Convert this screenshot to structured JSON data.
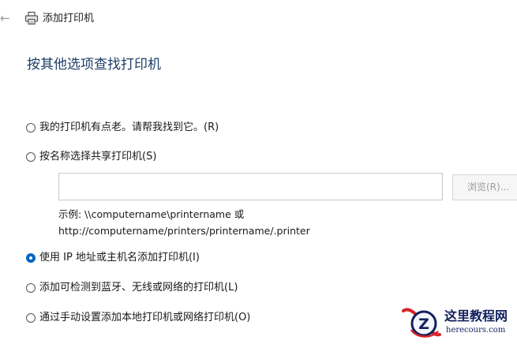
{
  "header": {
    "back_icon": "arrow-left-icon",
    "printer_icon": "printer-icon",
    "title": "添加打印机"
  },
  "page": {
    "heading": "按其他选项查找打印机"
  },
  "options": [
    {
      "label": "我的打印机有点老。请帮我找到它。(R)",
      "selected": false
    },
    {
      "label": "按名称选择共享打印机(S)",
      "selected": false
    },
    {
      "label": "使用 IP 地址或主机名添加打印机(I)",
      "selected": true
    },
    {
      "label": "添加可检测到蓝牙、无线或网络的打印机(L)",
      "selected": false
    },
    {
      "label": "通过手动设置添加本地打印机或网络打印机(O)",
      "selected": false
    }
  ],
  "shared_printer": {
    "input_value": "",
    "browse_label": "浏览(R)...",
    "example_line1": "示例: \\\\computername\\printername 或",
    "example_line2": "http://computername/printers/printername/.printer"
  },
  "watermark": {
    "title": "这里教程网",
    "url": "herecours.com"
  },
  "colors": {
    "accent": "#0067c0",
    "heading": "#1d3f66",
    "watermark_red": "#d8232a",
    "watermark_navy": "#12205e"
  }
}
